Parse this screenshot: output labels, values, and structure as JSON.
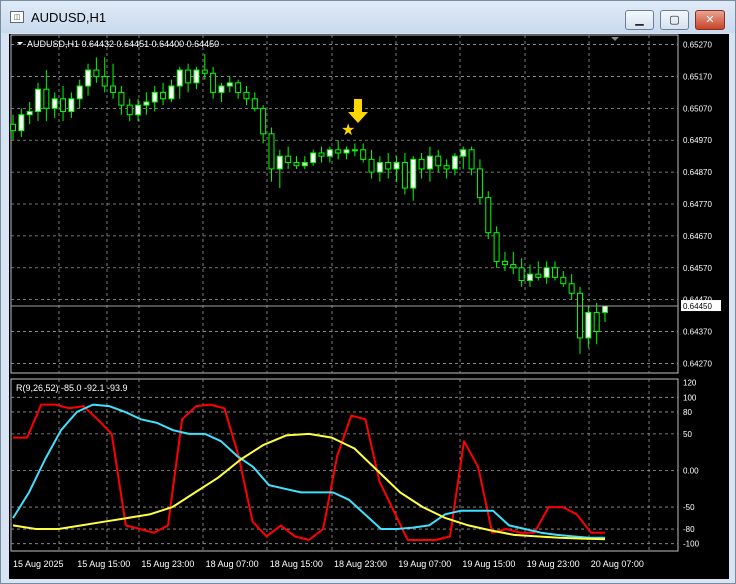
{
  "window": {
    "title": "AUDUSD,H1",
    "icon": "mt4-chart-icon",
    "buttons": {
      "minimize": "▁",
      "maximize": "▢",
      "close": "✕"
    }
  },
  "chart": {
    "header": "AUDUSD,H1  0.64432 0.64451 0.64400 0.64450",
    "current_price_label": "0.64450",
    "colors": {
      "background": "#000000",
      "grid": "#c0c0c0",
      "candle": "#00ff00",
      "bull_fill": "#ffffff",
      "bear_fill": "#000000",
      "arrow": "#ffd700"
    },
    "price_ticks": [
      "0.65270",
      "0.65170",
      "0.65070",
      "0.64970",
      "0.64870",
      "0.64770",
      "0.64670",
      "0.64570",
      "0.64470",
      "0.64370",
      "0.64270"
    ],
    "time_ticks": [
      "15 Aug 2025",
      "15 Aug 15:00",
      "15 Aug 23:00",
      "18 Aug 07:00",
      "18 Aug 15:00",
      "18 Aug 23:00",
      "19 Aug 07:00",
      "19 Aug 15:00",
      "19 Aug 23:00",
      "20 Aug 07:00"
    ]
  },
  "indicator": {
    "label": "R(9,26,52) -85.0 -92.1 -93.9",
    "ticks": [
      "120",
      "100",
      "80",
      "50",
      "0.00",
      "-50",
      "-80",
      "-100"
    ],
    "colors": [
      "#ff0000",
      "#40e0ff",
      "#ffff40"
    ]
  },
  "chart_data": [
    {
      "type": "candlestick",
      "title": "AUDUSD,H1",
      "ylim": [
        0.6424,
        0.653
      ],
      "x_labels": [
        "15 Aug 2025",
        "15 Aug 15:00",
        "15 Aug 23:00",
        "18 Aug 07:00",
        "18 Aug 15:00",
        "18 Aug 23:00",
        "19 Aug 07:00",
        "19 Aug 15:00",
        "19 Aug 23:00",
        "20 Aug 07:00"
      ],
      "last_price": 0.6445,
      "ohlc": [
        [
          0.6502,
          0.6505,
          0.6497,
          0.65
        ],
        [
          0.65,
          0.6507,
          0.6498,
          0.6505
        ],
        [
          0.6505,
          0.6509,
          0.6502,
          0.6506
        ],
        [
          0.6506,
          0.6515,
          0.6503,
          0.6513
        ],
        [
          0.6513,
          0.6519,
          0.6503,
          0.6507
        ],
        [
          0.6507,
          0.6512,
          0.6504,
          0.651
        ],
        [
          0.651,
          0.6514,
          0.6503,
          0.6506
        ],
        [
          0.6506,
          0.6512,
          0.6504,
          0.651
        ],
        [
          0.651,
          0.6516,
          0.6507,
          0.6514
        ],
        [
          0.6514,
          0.6521,
          0.6511,
          0.6519
        ],
        [
          0.6519,
          0.6523,
          0.6515,
          0.6517
        ],
        [
          0.6517,
          0.6523,
          0.6512,
          0.6514
        ],
        [
          0.6514,
          0.6521,
          0.651,
          0.6512
        ],
        [
          0.6512,
          0.6514,
          0.6505,
          0.6508
        ],
        [
          0.6508,
          0.651,
          0.6503,
          0.6505
        ],
        [
          0.6505,
          0.651,
          0.6503,
          0.6508
        ],
        [
          0.6508,
          0.6512,
          0.6505,
          0.6509
        ],
        [
          0.6509,
          0.6514,
          0.6506,
          0.6512
        ],
        [
          0.6512,
          0.6515,
          0.6508,
          0.651
        ],
        [
          0.651,
          0.6516,
          0.6509,
          0.6514
        ],
        [
          0.6514,
          0.652,
          0.651,
          0.6519
        ],
        [
          0.6519,
          0.6521,
          0.6512,
          0.6515
        ],
        [
          0.6515,
          0.652,
          0.6513,
          0.6519
        ],
        [
          0.6519,
          0.6524,
          0.6516,
          0.6518
        ],
        [
          0.6518,
          0.652,
          0.651,
          0.6512
        ],
        [
          0.6512,
          0.6515,
          0.6509,
          0.6514
        ],
        [
          0.6514,
          0.6517,
          0.6512,
          0.6515
        ],
        [
          0.6515,
          0.6516,
          0.651,
          0.6512
        ],
        [
          0.6512,
          0.6514,
          0.6508,
          0.651
        ],
        [
          0.651,
          0.6512,
          0.6506,
          0.6507
        ],
        [
          0.6507,
          0.6508,
          0.6496,
          0.6499
        ],
        [
          0.6499,
          0.6501,
          0.6484,
          0.6488
        ],
        [
          0.6488,
          0.6494,
          0.6482,
          0.6492
        ],
        [
          0.6492,
          0.6495,
          0.6488,
          0.649
        ],
        [
          0.649,
          0.6492,
          0.6488,
          0.6489
        ],
        [
          0.6489,
          0.6492,
          0.6488,
          0.649
        ],
        [
          0.649,
          0.6494,
          0.6489,
          0.6493
        ],
        [
          0.6493,
          0.6495,
          0.649,
          0.6492
        ],
        [
          0.6492,
          0.6495,
          0.649,
          0.6494
        ],
        [
          0.6494,
          0.6497,
          0.6491,
          0.6493
        ],
        [
          0.6493,
          0.6495,
          0.6491,
          0.6494
        ],
        [
          0.6494,
          0.6496,
          0.6492,
          0.6494
        ],
        [
          0.6494,
          0.6496,
          0.649,
          0.6491
        ],
        [
          0.6491,
          0.6494,
          0.6485,
          0.6487
        ],
        [
          0.6487,
          0.6492,
          0.6484,
          0.649
        ],
        [
          0.649,
          0.6493,
          0.6485,
          0.6488
        ],
        [
          0.6488,
          0.6492,
          0.6484,
          0.649
        ],
        [
          0.649,
          0.6493,
          0.648,
          0.6482
        ],
        [
          0.6482,
          0.6492,
          0.6478,
          0.6491
        ],
        [
          0.6491,
          0.6493,
          0.6485,
          0.6488
        ],
        [
          0.6488,
          0.6495,
          0.6484,
          0.6492
        ],
        [
          0.6492,
          0.6494,
          0.6487,
          0.6489
        ],
        [
          0.6489,
          0.6491,
          0.6485,
          0.6488
        ],
        [
          0.6488,
          0.6493,
          0.6486,
          0.6492
        ],
        [
          0.6492,
          0.6495,
          0.6488,
          0.6494
        ],
        [
          0.6494,
          0.6495,
          0.6486,
          0.6488
        ],
        [
          0.6488,
          0.6491,
          0.6477,
          0.6479
        ],
        [
          0.6479,
          0.6481,
          0.6466,
          0.6468
        ],
        [
          0.6468,
          0.647,
          0.6457,
          0.6459
        ],
        [
          0.6459,
          0.6462,
          0.6456,
          0.6458
        ],
        [
          0.6458,
          0.6462,
          0.6455,
          0.6457
        ],
        [
          0.6457,
          0.646,
          0.6451,
          0.6453
        ],
        [
          0.6453,
          0.6458,
          0.6451,
          0.6455
        ],
        [
          0.6455,
          0.6459,
          0.6453,
          0.6454
        ],
        [
          0.6454,
          0.6459,
          0.6452,
          0.6457
        ],
        [
          0.6457,
          0.6459,
          0.6453,
          0.6454
        ],
        [
          0.6454,
          0.6456,
          0.6451,
          0.6452
        ],
        [
          0.6452,
          0.6455,
          0.6447,
          0.6449
        ],
        [
          0.6449,
          0.6451,
          0.643,
          0.6435
        ],
        [
          0.6435,
          0.6445,
          0.6432,
          0.6443
        ],
        [
          0.6443,
          0.6446,
          0.6433,
          0.6437
        ],
        [
          0.6443,
          0.6445,
          0.644,
          0.6445
        ]
      ]
    },
    {
      "type": "line",
      "title": "R(9,26,52) -85.0 -92.1 -93.9",
      "ylim": [
        -110,
        125
      ],
      "series": [
        {
          "name": "9",
          "values": [
            45,
            45,
            90,
            90,
            85,
            88,
            70,
            50,
            -75,
            -80,
            -85,
            -75,
            70,
            88,
            90,
            85,
            20,
            -70,
            -90,
            -75,
            -90,
            -95,
            -80,
            20,
            75,
            70,
            -15,
            -55,
            -95,
            -95,
            -95,
            -90,
            40,
            5,
            -85,
            -80,
            -85,
            -85,
            -50,
            -50,
            -60,
            -85,
            -85
          ]
        },
        {
          "name": "26",
          "values": [
            -65,
            -30,
            15,
            55,
            80,
            90,
            88,
            80,
            70,
            65,
            55,
            50,
            50,
            40,
            20,
            5,
            -20,
            -25,
            -30,
            -30,
            -30,
            -40,
            -60,
            -80,
            -80,
            -78,
            -75,
            -60,
            -55,
            -55,
            -55,
            -75,
            -80,
            -85,
            -88,
            -90,
            -92,
            -92
          ]
        },
        {
          "name": "52",
          "values": [
            -75,
            -80,
            -80,
            -75,
            -70,
            -65,
            -60,
            -50,
            -30,
            -10,
            15,
            35,
            48,
            50,
            45,
            30,
            0,
            -30,
            -50,
            -65,
            -75,
            -82,
            -88,
            -90,
            -92,
            -93,
            -94
          ]
        }
      ]
    }
  ]
}
